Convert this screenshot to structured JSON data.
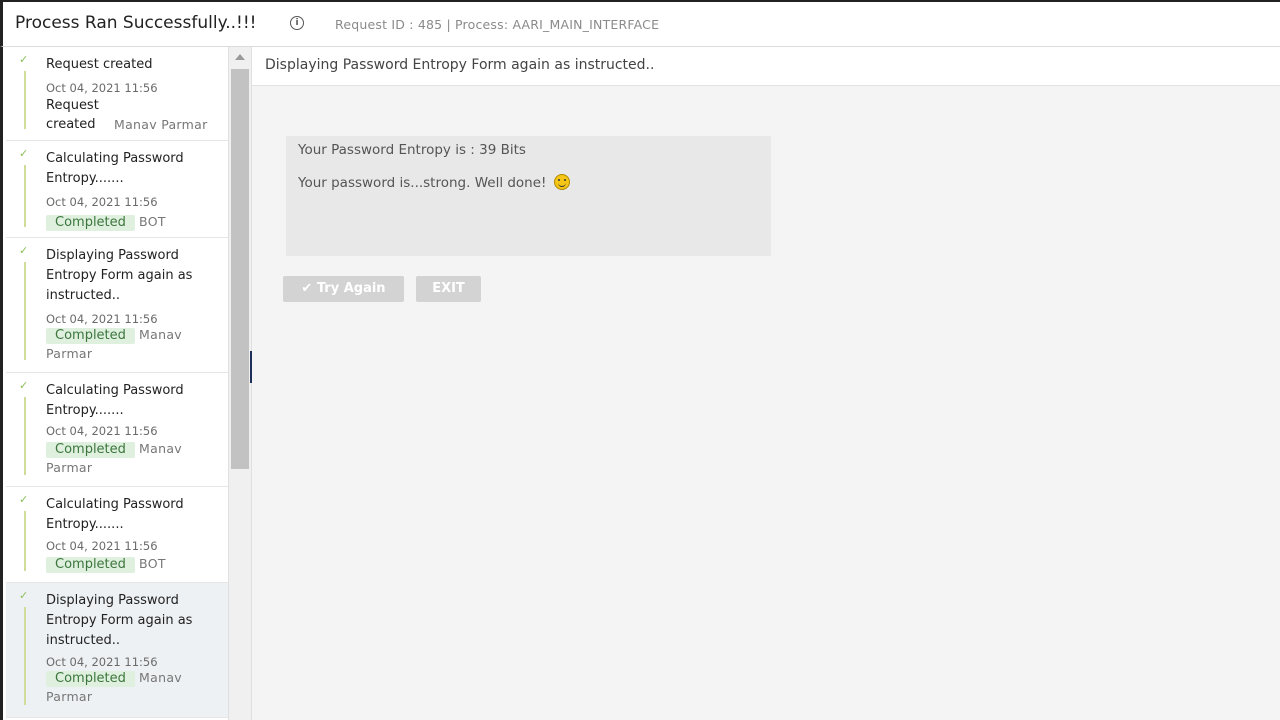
{
  "header": {
    "title": "Process Ran Successfully..!!!",
    "meta": "Request ID : 485 | Process: AARI_MAIN_INTERFACE"
  },
  "timeline": [
    {
      "title": "Request created",
      "time": "Oct 04, 2021 11:56",
      "status": "Request created",
      "who": "Manav Parmar"
    },
    {
      "title": "Calculating Password Entropy.......",
      "time": "Oct 04, 2021 11:56",
      "status": "Completed",
      "who": "BOT"
    },
    {
      "title": "Displaying Password Entropy Form again as instructed..",
      "time": "Oct 04, 2021 11:56",
      "status": "Completed",
      "who": "Manav Parmar"
    },
    {
      "title": "Calculating Password Entropy.......",
      "time": "Oct 04, 2021 11:56",
      "status": "Completed",
      "who": "Manav Parmar"
    },
    {
      "title": "Calculating Password Entropy.......",
      "time": "Oct 04, 2021 11:56",
      "status": "Completed",
      "who": "BOT"
    },
    {
      "title": "Displaying Password Entropy Form again as instructed..",
      "time": "Oct 04, 2021 11:56",
      "status": "Completed",
      "who": "Manav Parmar"
    }
  ],
  "main": {
    "subheader": "Displaying Password Entropy Form again as instructed..",
    "entropy_line": "Your Password Entropy is : 39 Bits",
    "strength_line": "Your password is...strong. Well done!",
    "try_again_label": "Try Again",
    "exit_label": "EXIT"
  },
  "colors": {
    "badge_bg": "#dff0df",
    "badge_text": "#3c763d",
    "check": "#8bbf5a",
    "button_disabled": "#d3d3d3",
    "divider_handle": "#1e2f5a"
  }
}
